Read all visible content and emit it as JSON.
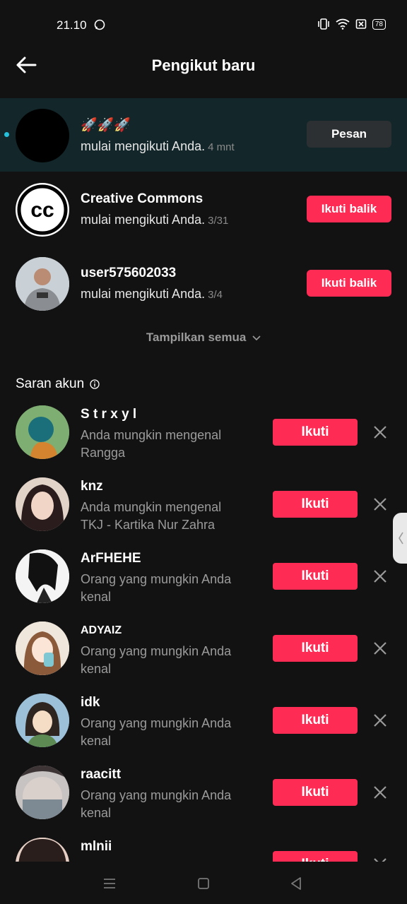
{
  "status": {
    "time": "21.10",
    "battery": "78"
  },
  "header": {
    "title": "Pengikut baru"
  },
  "followers": [
    {
      "name": "🚀🚀🚀",
      "action": "mulai mengikuti Anda.",
      "time": "4 mnt",
      "button": "Pesan"
    },
    {
      "name": "Creative Commons",
      "action": "mulai mengikuti Anda.",
      "time": "3/31",
      "button": "Ikuti balik"
    },
    {
      "name": "user575602033",
      "action": "mulai mengikuti Anda.",
      "time": "3/4",
      "button": "Ikuti balik"
    }
  ],
  "show_all": "Tampilkan semua",
  "suggestions_title": "Saran akun",
  "suggestions": [
    {
      "name": "S t r x y l",
      "line1": "Anda mungkin mengenal",
      "line2": "Rangga",
      "button": "Ikuti"
    },
    {
      "name": "knz",
      "line1": "Anda mungkin mengenal",
      "line2": "TKJ - Kartika Nur Zahra",
      "button": "Ikuti"
    },
    {
      "name": "ArFHEHE",
      "line1": "Orang yang mungkin Anda",
      "line2": "kenal",
      "button": "Ikuti"
    },
    {
      "name": "ADYAIZ",
      "line1": "Orang yang mungkin Anda",
      "line2": "kenal",
      "button": "Ikuti"
    },
    {
      "name": "idk",
      "line1": "Orang yang mungkin Anda",
      "line2": "kenal",
      "button": "Ikuti"
    },
    {
      "name": "raacitt",
      "line1": "Orang yang mungkin Anda",
      "line2": "kenal",
      "button": "Ikuti"
    },
    {
      "name": "mlnii",
      "line1": "",
      "line2": "",
      "button": "Ikuti"
    }
  ],
  "colors": {
    "accent": "#fe2c55",
    "highlight": "#13272a",
    "unread_dot": "#25c1dc"
  }
}
